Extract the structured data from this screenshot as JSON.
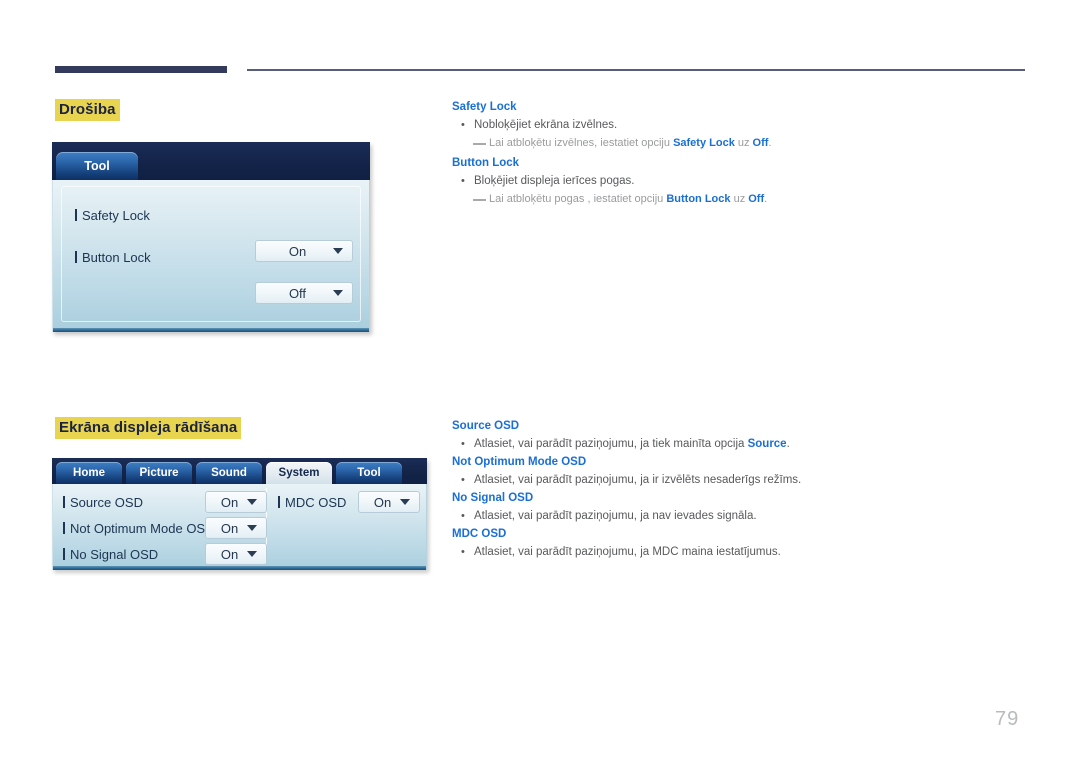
{
  "page": {
    "number": "79"
  },
  "sections": [
    {
      "heading": "Drošiba",
      "panel": {
        "tabs": [
          {
            "label": "Tool",
            "active": false
          }
        ],
        "rows": [
          {
            "label": "Safety Lock",
            "value": "On"
          },
          {
            "label": "Button Lock",
            "value": "Off"
          }
        ]
      },
      "notes": [
        {
          "title": "Safety Lock",
          "bullet_marker": "•",
          "bullet": "Nobloķējiet ekrāna izvēlnes.",
          "note_pre": "Lai atbloķētu izvēlnes, iestatiet opciju ",
          "note_term1": "Safety Lock",
          "note_mid": " uz ",
          "note_term2": "Off",
          "note_post": "."
        },
        {
          "title": "Button Lock",
          "bullet_marker": "•",
          "bullet": "Bloķējiet displeja ierīces pogas.",
          "note_pre": "Lai atbloķētu pogas , iestatiet opciju ",
          "note_term1": "Button Lock",
          "note_mid": " uz ",
          "note_term2": "Off",
          "note_post": "."
        }
      ]
    },
    {
      "heading": "Ekrāna displeja rādīšana",
      "panel": {
        "tabs": [
          {
            "label": "Home",
            "active": false
          },
          {
            "label": "Picture",
            "active": false
          },
          {
            "label": "Sound",
            "active": false
          },
          {
            "label": "System",
            "active": true
          },
          {
            "label": "Tool",
            "active": false
          }
        ],
        "rows_left": [
          {
            "label": "Source OSD",
            "value": "On"
          },
          {
            "label": "Not Optimum Mode OSD",
            "value": "On"
          },
          {
            "label": "No Signal OSD",
            "value": "On"
          }
        ],
        "rows_right": [
          {
            "label": "MDC OSD",
            "value": "On"
          }
        ]
      },
      "notes": [
        {
          "title": "Source OSD",
          "bullet_marker": "•",
          "bullet_pre": "Atlasiet, vai parādīt paziņojumu, ja tiek mainīta opcija ",
          "bullet_term": "Source",
          "bullet_post": "."
        },
        {
          "title": "Not Optimum Mode OSD",
          "bullet_marker": "•",
          "bullet_pre": "Atlasiet, vai parādīt paziņojumu, ja ir izvēlēts nesaderīgs režīms.",
          "bullet_term": "",
          "bullet_post": ""
        },
        {
          "title": "No Signal OSD",
          "bullet_marker": "•",
          "bullet_pre": "Atlasiet, vai parādīt paziņojumu, ja nav ievades signāla.",
          "bullet_term": "",
          "bullet_post": ""
        },
        {
          "title": "MDC OSD",
          "bullet_marker": "•",
          "bullet_pre": "Atlasiet, vai parādīt paziņojumu, ja MDC maina iestatījumus.",
          "bullet_term": "",
          "bullet_post": ""
        }
      ]
    }
  ],
  "icons": {
    "caret": "chevron-down-icon",
    "list_bullet": "bullet-icon",
    "note_dash": "note-dash-icon"
  },
  "colors": {
    "heading_highlight": "#e8d44e",
    "heading_text": "#1c2340",
    "link_blue": "#1a6fd4",
    "body_gray": "#58595b",
    "note_gray": "#9a9b9d",
    "rule_navy": "#333a5c",
    "panel_header_navy": "#15254b"
  }
}
